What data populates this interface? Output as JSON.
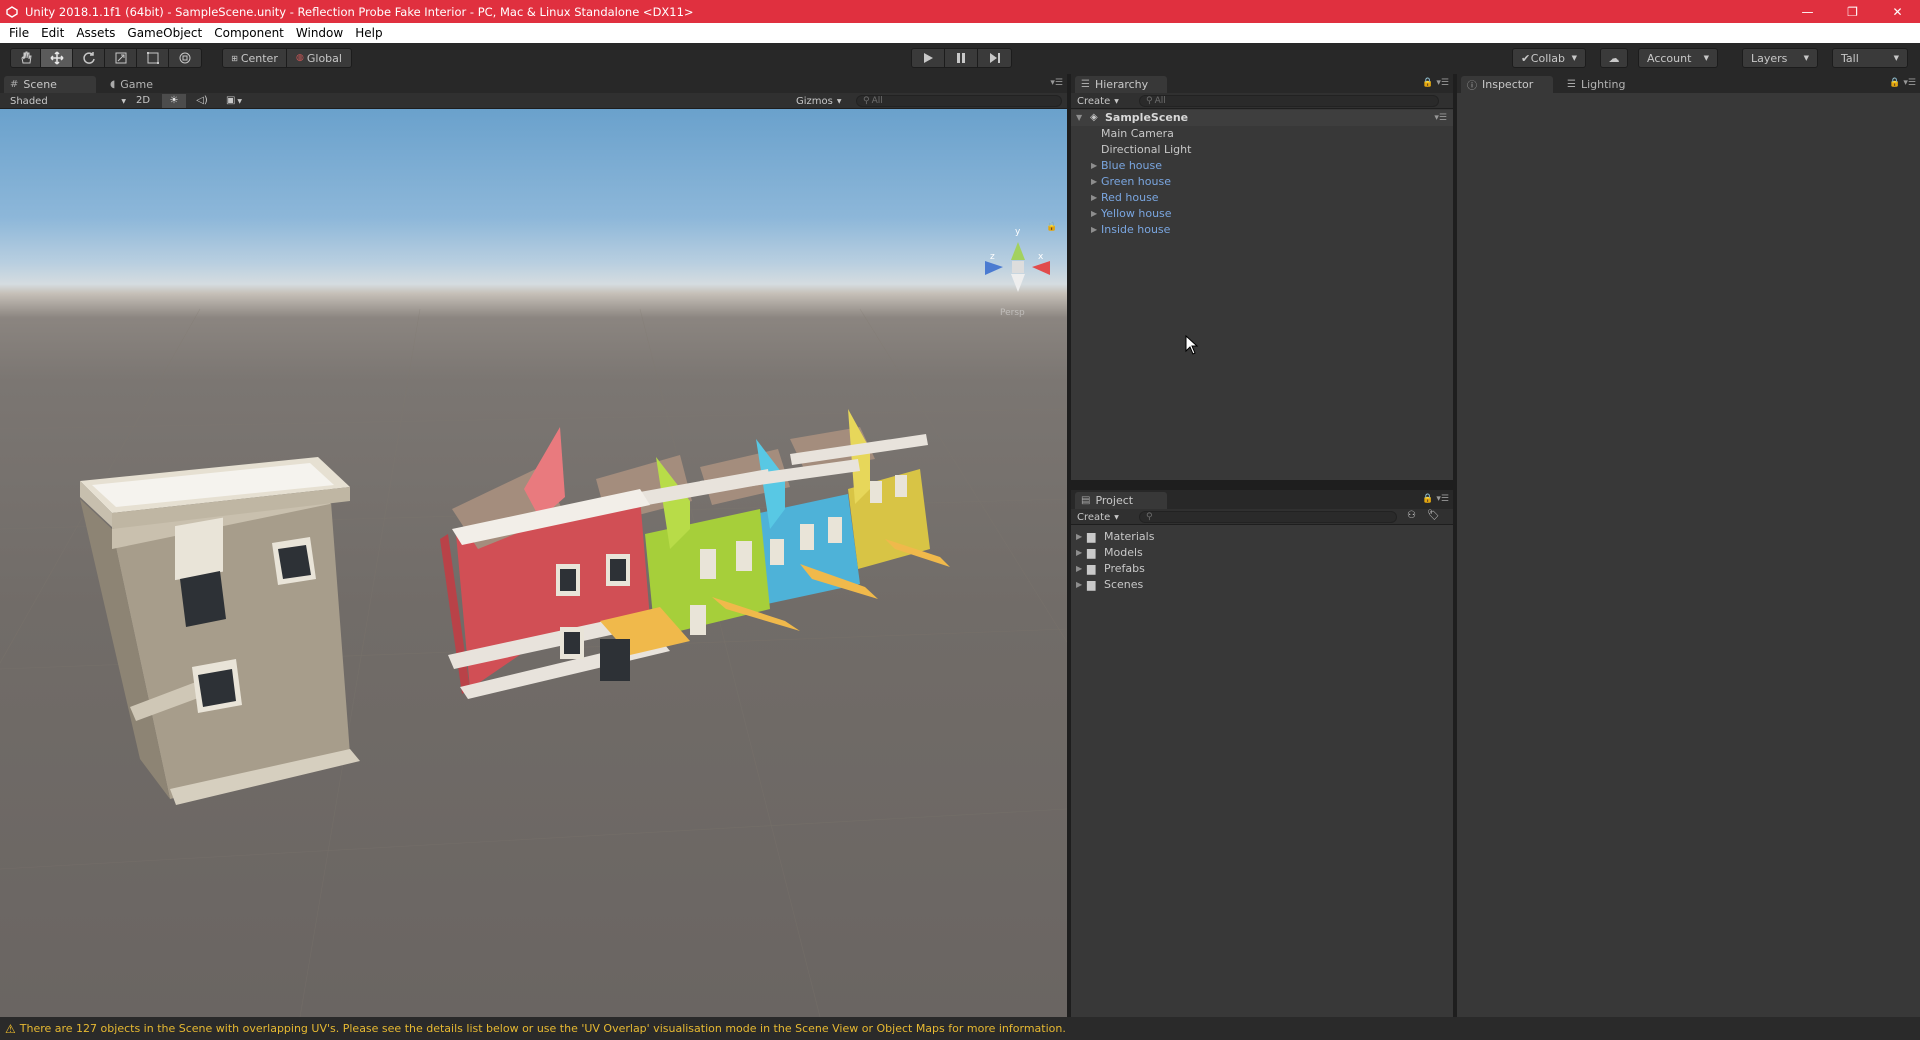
{
  "window": {
    "title": "Unity 2018.1.1f1 (64bit) - SampleScene.unity - Reflection Probe Fake Interior - PC, Mac & Linux Standalone <DX11>",
    "controls": [
      "—",
      "❐",
      "✕"
    ]
  },
  "menu": [
    "File",
    "Edit",
    "Assets",
    "GameObject",
    "Component",
    "Window",
    "Help"
  ],
  "toolbar": {
    "pivot": "Center",
    "space": "Global",
    "collab": "Collab",
    "account": "Account",
    "layers": "Layers",
    "layout": "Tall"
  },
  "scene_panel": {
    "tabs": [
      "Scene",
      "Game"
    ],
    "shading": "Shaded",
    "mode_2d": "2D",
    "gizmos": "Gizmos",
    "search_placeholder": "All",
    "gizmo_axis_y": "y",
    "gizmo_axis_x": "x",
    "gizmo_axis_z": "z",
    "gizmo_label": "Persp"
  },
  "hierarchy": {
    "tab": "Hierarchy",
    "create": "Create",
    "search_placeholder": "All",
    "scene": "SampleScene",
    "items": [
      {
        "name": "Main Camera",
        "prefab": false,
        "expandable": false
      },
      {
        "name": "Directional Light",
        "prefab": false,
        "expandable": false
      },
      {
        "name": "Blue house",
        "prefab": true,
        "expandable": true
      },
      {
        "name": "Green house",
        "prefab": true,
        "expandable": true
      },
      {
        "name": "Red house",
        "prefab": true,
        "expandable": true
      },
      {
        "name": "Yellow house",
        "prefab": true,
        "expandable": true
      },
      {
        "name": "Inside house",
        "prefab": true,
        "expandable": true
      }
    ]
  },
  "project": {
    "tab": "Project",
    "create": "Create",
    "folders": [
      "Materials",
      "Models",
      "Prefabs",
      "Scenes"
    ]
  },
  "inspector": {
    "tabs": [
      "Inspector",
      "Lighting"
    ]
  },
  "status": {
    "message": "There are 127 objects in the Scene with overlapping UV's. Please see the details list below or use the 'UV Overlap' visualisation mode in the Scene View or Object Maps for more information."
  },
  "colors": {
    "titlebar": "#e0303f",
    "prefab_text": "#7aa6e0",
    "warning": "#e7b932",
    "red_house": "#d14f55",
    "green_house": "#a6cf3a",
    "blue_house": "#4eb2d8",
    "yellow_house": "#d8c445",
    "inside_house": "#a79d8b"
  }
}
